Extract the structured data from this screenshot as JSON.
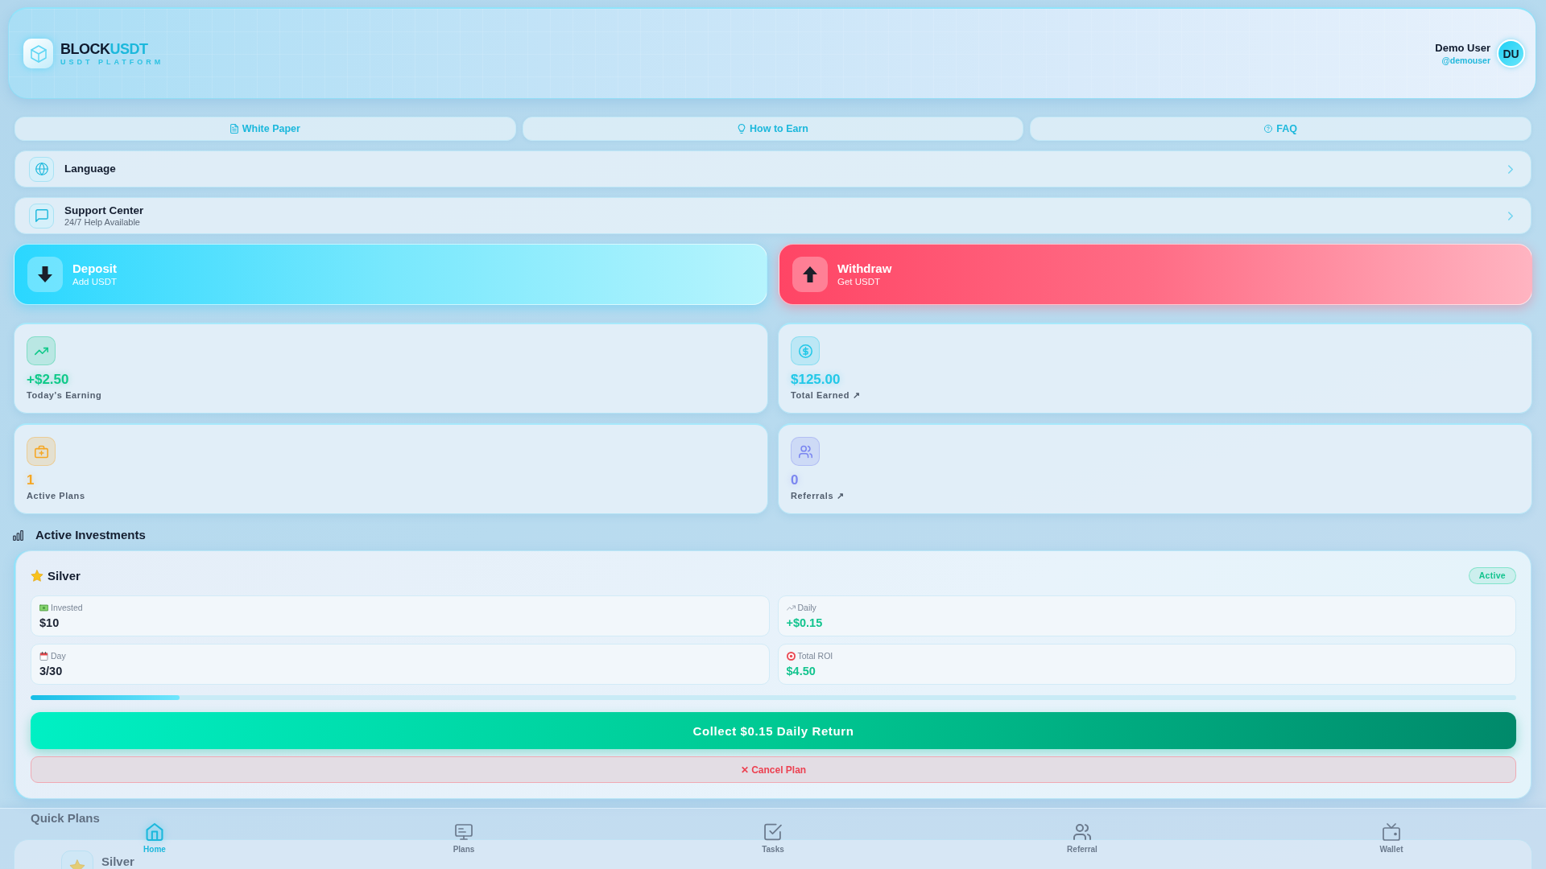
{
  "header": {
    "brand": {
      "main": "BLOCK",
      "accent": "USDT"
    },
    "tagline": "USDT PLATFORM",
    "user": {
      "name": "Demo User",
      "handle": "@demouser",
      "initials": "DU"
    }
  },
  "links": [
    {
      "label": "White Paper"
    },
    {
      "label": "How to Earn"
    },
    {
      "label": "FAQ"
    }
  ],
  "menu": [
    {
      "title": "Language"
    },
    {
      "title": "Support Center",
      "subtitle": "24/7 Help Available"
    }
  ],
  "actions": [
    {
      "kind": "deposit",
      "title": "Deposit",
      "subtitle": "Add USDT"
    },
    {
      "kind": "withdraw",
      "title": "Withdraw",
      "subtitle": "Get USDT"
    }
  ],
  "stats": [
    {
      "value": "+$2.50",
      "label": "Today's Earning",
      "color": "#10c98a"
    },
    {
      "value": "$125.00",
      "label": "Total Earned ↗",
      "color": "#22c8e8"
    },
    {
      "value": "1",
      "label": "Active Plans",
      "color": "#f5a623"
    },
    {
      "value": "0",
      "label": "Referrals ↗",
      "color": "#7b86f0"
    }
  ],
  "active_investments": {
    "title": "Active Investments",
    "plans": [
      {
        "name": "Silver",
        "status": "Active",
        "details": [
          {
            "label": "Invested",
            "value": "$10",
            "color": "#1a2232"
          },
          {
            "label": "Daily",
            "value": "+$0.15",
            "color": "#12c48e"
          },
          {
            "label": "Day",
            "value": "3/30",
            "color": "#1a2232"
          },
          {
            "label": "Total ROI",
            "value": "$4.50",
            "color": "#12c48e"
          }
        ],
        "level": 0.1,
        "collect_button": "Collect $0.15 Daily Return",
        "cancel_button": "✕ Cancel Plan"
      }
    ]
  },
  "quick_plans": {
    "title": "Quick Plans",
    "plans": [
      {
        "name": "Silver"
      }
    ]
  },
  "bottom_nav": [
    {
      "label": "Home",
      "selected": true
    },
    {
      "label": "Plans",
      "selected": false
    },
    {
      "label": "Tasks",
      "selected": false
    },
    {
      "label": "Referral",
      "selected": false
    },
    {
      "label": "Wallet",
      "selected": false
    }
  ]
}
